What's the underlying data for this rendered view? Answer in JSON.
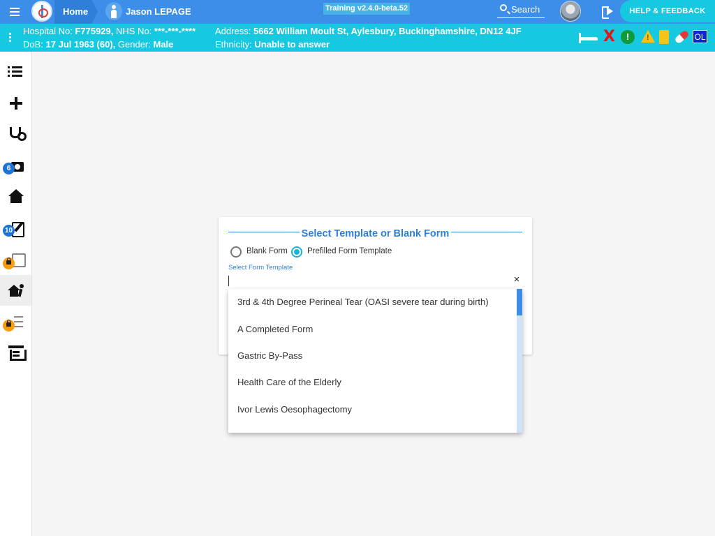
{
  "topbar": {
    "home_label": "Home",
    "patient_name": "Jason LEPAGE",
    "environment": "Training v2.4.0-beta.52",
    "search_label": "Search",
    "help_label": "HELP & FEEDBACK"
  },
  "banner": {
    "hospital_no_label": "Hospital No:",
    "hospital_no": "F775929,",
    "nhs_no_label": "NHS No:",
    "nhs_no": "***-***-****",
    "dob_label": "DoB:",
    "dob": "17 Jul 1963 (60),",
    "gender_label": "Gender:",
    "gender": "Male",
    "address_label": "Address:",
    "address": "5662 William Moult St, Aylesbury, Buckinghamshire, DN12 4JF",
    "ethnicity_label": "Ethnicity:",
    "ethnicity": "Unable to answer",
    "alert_icons": [
      "bed-icon",
      "x-icon",
      "exclamation-icon",
      "warning-icon",
      "document-icon",
      "pill-icon",
      "ol-badge"
    ],
    "ol_label": "OL",
    "warn_glyph": "!",
    "excl_glyph": "!",
    "x_glyph": "X"
  },
  "sidebar": {
    "items": [
      {
        "name": "list",
        "badge": ""
      },
      {
        "name": "add",
        "badge": ""
      },
      {
        "name": "stethoscope",
        "badge": ""
      },
      {
        "name": "camera",
        "badge": "6"
      },
      {
        "name": "house-medical",
        "badge": ""
      },
      {
        "name": "edit-note",
        "badge": "10"
      },
      {
        "name": "clipboard-locked",
        "badge": ""
      },
      {
        "name": "house-walk",
        "badge": ""
      },
      {
        "name": "checklist-locked",
        "badge": ""
      },
      {
        "name": "ward",
        "badge": ""
      }
    ],
    "colors": {
      "count_badge": "#1e73d8",
      "lock_badge": "#f89c0a"
    }
  },
  "form": {
    "title": "Select Template or Blank Form",
    "radio_blank": "Blank Form",
    "radio_prefilled": "Prefilled Form Template",
    "selected": "prefilled",
    "field_label": "Select Form Template",
    "field_value": "",
    "clear_glyph": "×"
  },
  "dropdown": {
    "options": [
      "3rd & 4th Degree Perineal Tear (OASI severe tear during birth)",
      "A Completed Form",
      "Gastric By-Pass",
      "Health Care of the Elderly",
      "Ivor Lewis Oesophagectomy"
    ]
  },
  "colors": {
    "topbar": "#3d8ee8",
    "banner": "#16c8e0",
    "accent": "#2f7fd8",
    "radio_checked": "#16b4d6"
  }
}
